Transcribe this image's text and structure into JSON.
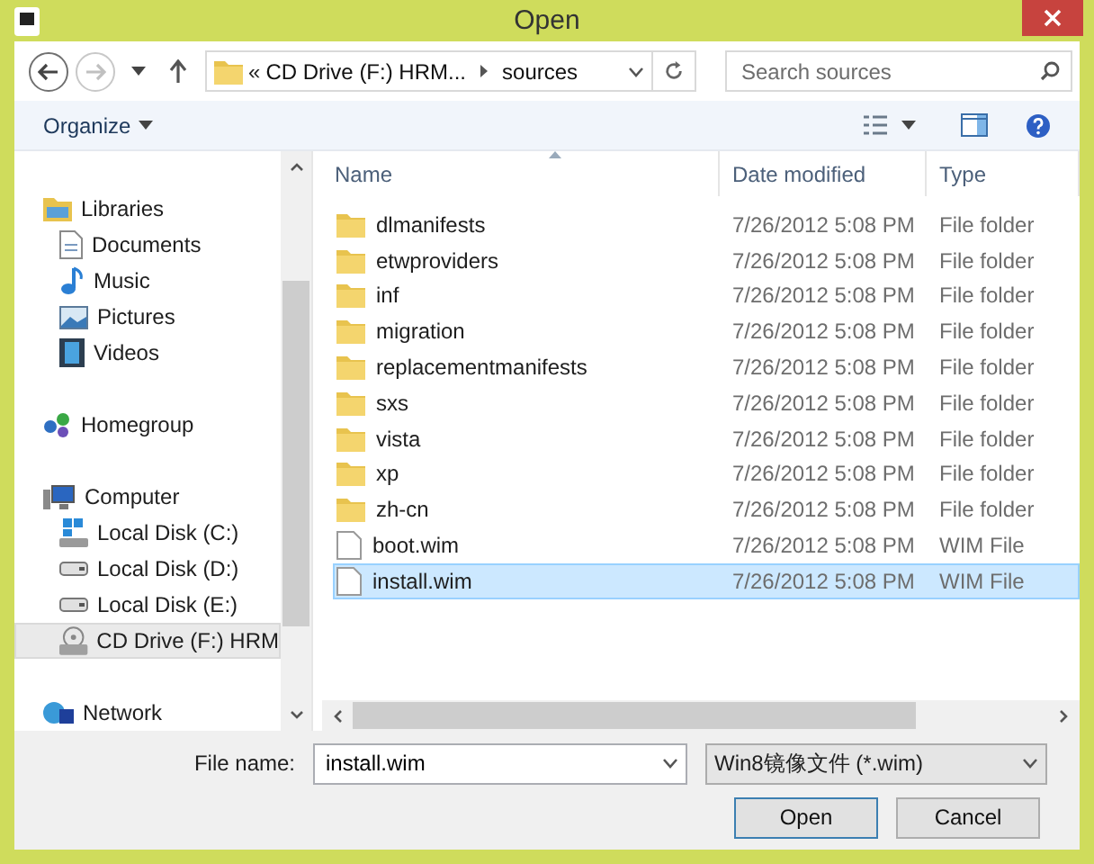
{
  "window": {
    "title": "Open"
  },
  "nav": {
    "back_disabled": false,
    "forward_disabled": true,
    "address_prefix": "«",
    "address_segments": [
      "CD Drive (F:) HRM...",
      "sources"
    ],
    "search": {
      "placeholder": "Search sources"
    }
  },
  "toolbar": {
    "organize": "Organize"
  },
  "sidebar": {
    "items": [
      {
        "label": "Libraries",
        "kind": "libraries",
        "selected": false,
        "children": [
          {
            "label": "Documents",
            "kind": "documents",
            "selected": false
          },
          {
            "label": "Music",
            "kind": "music",
            "selected": false
          },
          {
            "label": "Pictures",
            "kind": "pictures",
            "selected": false
          },
          {
            "label": "Videos",
            "kind": "videos",
            "selected": false
          }
        ]
      },
      {
        "label": "Homegroup",
        "kind": "homegroup",
        "selected": false
      },
      {
        "label": "Computer",
        "kind": "computer",
        "selected": false,
        "children": [
          {
            "label": "Local Disk (C:)",
            "kind": "system-disk",
            "selected": false
          },
          {
            "label": "Local Disk (D:)",
            "kind": "disk",
            "selected": false
          },
          {
            "label": "Local Disk (E:)",
            "kind": "disk",
            "selected": false
          },
          {
            "label": "CD Drive (F:) HRM",
            "kind": "cd",
            "selected": true
          }
        ]
      },
      {
        "label": "Network",
        "kind": "network",
        "selected": false
      }
    ]
  },
  "table": {
    "columns": [
      "Name",
      "Date modified",
      "Type"
    ],
    "rows": [
      {
        "name": "dlmanifests",
        "date": "7/26/2012 5:08 PM",
        "type": "File folder",
        "kind": "folder",
        "selected": false
      },
      {
        "name": "etwproviders",
        "date": "7/26/2012 5:08 PM",
        "type": "File folder",
        "kind": "folder",
        "selected": false
      },
      {
        "name": "inf",
        "date": "7/26/2012 5:08 PM",
        "type": "File folder",
        "kind": "folder",
        "selected": false
      },
      {
        "name": "migration",
        "date": "7/26/2012 5:08 PM",
        "type": "File folder",
        "kind": "folder",
        "selected": false
      },
      {
        "name": "replacementmanifests",
        "date": "7/26/2012 5:08 PM",
        "type": "File folder",
        "kind": "folder",
        "selected": false
      },
      {
        "name": "sxs",
        "date": "7/26/2012 5:08 PM",
        "type": "File folder",
        "kind": "folder",
        "selected": false
      },
      {
        "name": "vista",
        "date": "7/26/2012 5:08 PM",
        "type": "File folder",
        "kind": "folder",
        "selected": false
      },
      {
        "name": "xp",
        "date": "7/26/2012 5:08 PM",
        "type": "File folder",
        "kind": "folder",
        "selected": false
      },
      {
        "name": "zh-cn",
        "date": "7/26/2012 5:08 PM",
        "type": "File folder",
        "kind": "folder",
        "selected": false
      },
      {
        "name": "boot.wim",
        "date": "7/26/2012 5:08 PM",
        "type": "WIM File",
        "kind": "file",
        "selected": false
      },
      {
        "name": "install.wim",
        "date": "7/26/2012 5:08 PM",
        "type": "WIM File",
        "kind": "file",
        "selected": true
      }
    ]
  },
  "footer": {
    "file_name_label": "File name:",
    "file_name": "install.wim",
    "file_type": "Win8镜像文件 (*.wim)",
    "buttons": [
      "Open",
      "Cancel"
    ]
  }
}
